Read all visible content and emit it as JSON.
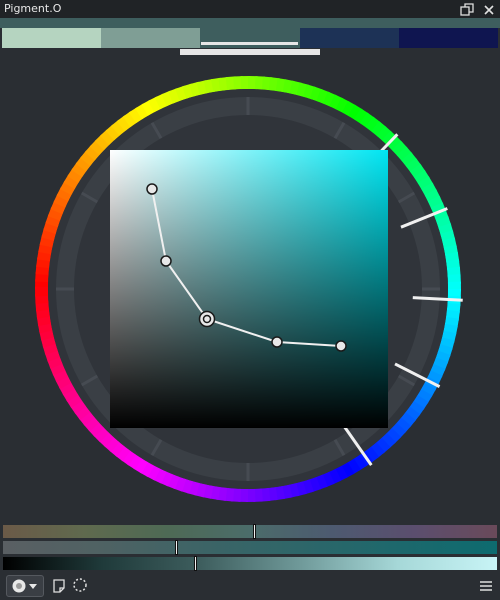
{
  "window": {
    "title": "Pigment.O"
  },
  "icons": {
    "float": "float-window-icon",
    "close": "close-icon",
    "mode": "wheel-mode-icon",
    "note": "note-icon",
    "dotted_circle": "dotted-circle-icon",
    "menu": "hamburger-menu-icon"
  },
  "palette": {
    "swatches": [
      "#b5d4c0",
      "#7f9e95",
      "#3e5e5e",
      "#1d3256",
      "#0f1550"
    ],
    "selected_index": 2
  },
  "square": {
    "hue_color": "#00e6f2",
    "curve_points": 5,
    "active_point_index": 2
  },
  "sliders": [
    {
      "name": "hue",
      "value": 0.51
    },
    {
      "name": "saturation",
      "value": 0.35
    },
    {
      "name": "value",
      "value": 0.39
    }
  ],
  "colors": {
    "accent": "#00e6f2",
    "background": "#2a2e33"
  }
}
